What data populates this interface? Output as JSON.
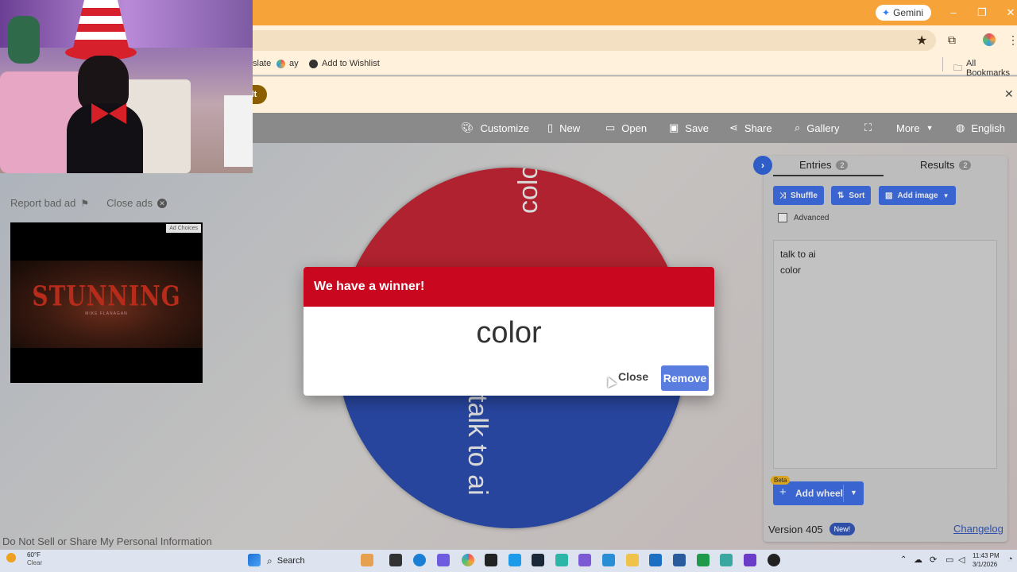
{
  "browser": {
    "gemini_label": "Gemini",
    "bookmarks": [
      "slate",
      "ay",
      "Add to Wishlist"
    ],
    "all_bookmarks": "All Bookmarks",
    "info_badge": "lt"
  },
  "toolbar": {
    "customize": "Customize",
    "new": "New",
    "open": "Open",
    "save": "Save",
    "share": "Share",
    "gallery": "Gallery",
    "more": "More",
    "language": "English"
  },
  "ads": {
    "report": "Report bad ad",
    "close": "Close ads",
    "choices": "Ad Choices",
    "title": "STUNNING",
    "subtitle": "MIKE FLANAGAN"
  },
  "wheel": {
    "segments": [
      {
        "label": "color",
        "color": "#b0222f"
      },
      {
        "label": "talk to ai",
        "color": "#27459d"
      }
    ]
  },
  "modal": {
    "header": "We have a winner!",
    "winner": "color",
    "close": "Close",
    "remove": "Remove"
  },
  "panel": {
    "entries_tab": "Entries",
    "entries_count": "2",
    "results_tab": "Results",
    "results_count": "2",
    "shuffle": "Shuffle",
    "sort": "Sort",
    "add_image": "Add image",
    "advanced": "Advanced",
    "entries": [
      "talk to ai",
      "color"
    ],
    "beta": "Beta",
    "add_wheel": "Add wheel",
    "version": "Version 405",
    "new_badge": "New!",
    "changelog": "Changelog"
  },
  "footer": {
    "privacy": "Do Not Sell or Share My Personal Information"
  },
  "taskbar": {
    "weather_temp": "60°F",
    "weather_cond": "Clear",
    "search": "Search",
    "time": "11:43 PM",
    "date": "3/1/2026"
  },
  "colors": {
    "accent_blue": "#3a64d0",
    "winner_red": "#c9081f",
    "chrome_orange": "#f6a43a"
  }
}
